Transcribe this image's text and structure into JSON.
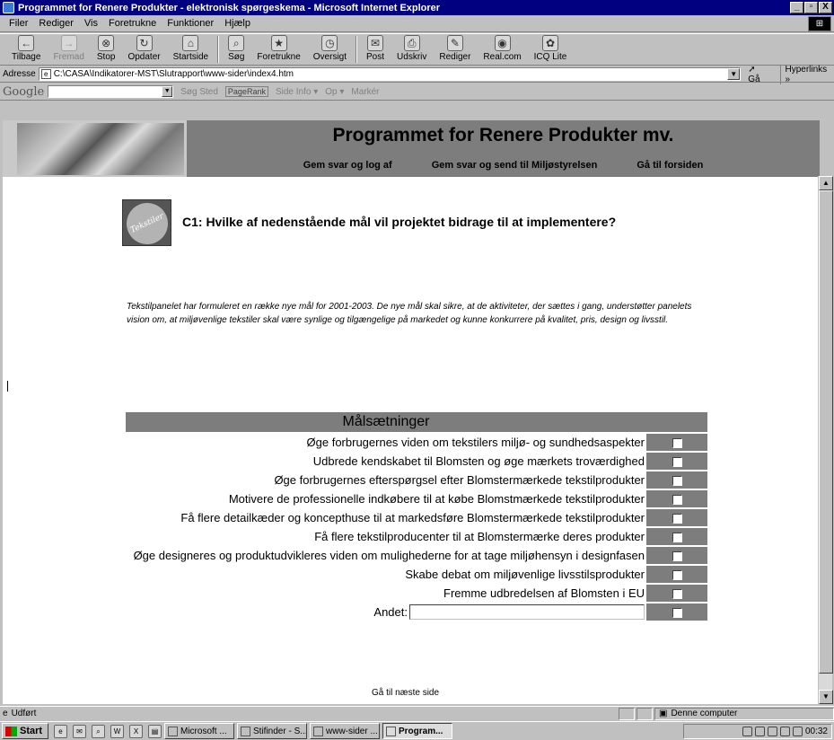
{
  "window": {
    "title": "Programmet for Renere Produkter - elektronisk spørgeskema - Microsoft Internet Explorer",
    "minimize": "_",
    "maximize": "▫",
    "close": "X"
  },
  "menubar": {
    "items": [
      "Filer",
      "Rediger",
      "Vis",
      "Foretrukne",
      "Funktioner",
      "Hjælp"
    ]
  },
  "toolbar": {
    "buttons": [
      {
        "label": "Tilbage",
        "icon": "back-arrow-icon",
        "glyph": "←",
        "enabled": true
      },
      {
        "label": "Fremad",
        "icon": "forward-arrow-icon",
        "glyph": "→",
        "enabled": false
      },
      {
        "label": "Stop",
        "icon": "stop-icon",
        "glyph": "⊗",
        "enabled": true
      },
      {
        "label": "Opdater",
        "icon": "refresh-icon",
        "glyph": "↻",
        "enabled": true
      },
      {
        "label": "Startside",
        "icon": "home-icon",
        "glyph": "⌂",
        "enabled": true
      },
      {
        "label": "Søg",
        "icon": "search-icon",
        "glyph": "⌕",
        "enabled": true
      },
      {
        "label": "Foretrukne",
        "icon": "favorites-icon",
        "glyph": "★",
        "enabled": true
      },
      {
        "label": "Oversigt",
        "icon": "history-icon",
        "glyph": "◷",
        "enabled": true
      },
      {
        "label": "Post",
        "icon": "mail-icon",
        "glyph": "✉",
        "enabled": true
      },
      {
        "label": "Udskriv",
        "icon": "print-icon",
        "glyph": "⎙",
        "enabled": true
      },
      {
        "label": "Rediger",
        "icon": "edit-icon",
        "glyph": "✎",
        "enabled": true
      },
      {
        "label": "Real.com",
        "icon": "realcom-icon",
        "glyph": "◉",
        "enabled": true
      },
      {
        "label": "ICQ Lite",
        "icon": "icq-icon",
        "glyph": "✿",
        "enabled": true
      }
    ]
  },
  "addressbar": {
    "label": "Adresse",
    "url": "C:\\CASA\\Indikatorer-MST\\Slutrapport\\www-sider\\index4.htm",
    "go_label": "Gå",
    "links_label": "Hyperlinks »"
  },
  "googlebar": {
    "logo": "Google",
    "items": [
      "Søg Sted",
      "PageRank",
      "Side Info ▾",
      "Op ▾",
      "Markér"
    ]
  },
  "page": {
    "site_title": "Programmet for Renere Produkter mv.",
    "nav": [
      "Gem svar og log af",
      "Gem svar og send til Miljøstyrelsen",
      "Gå til forsiden"
    ],
    "icon_caption": "Tekstiler",
    "question": "C1: Hvilke af nedenstående mål vil projektet bidrage til at implementere?",
    "intro": "Tekstilpanelet har formuleret en række nye mål for 2001-2003. De nye mål skal sikre, at de aktiviteter, der sættes i gang, understøtter panelets vision om, at miljøvenlige tekstiler skal være synlige og tilgængelige på markedet og kunne konkurrere på kvalitet, pris, design og livsstil.",
    "table_header": "Målsætninger",
    "goals": [
      "Øge forbrugernes viden om tekstilers miljø- og sundhedsaspekter",
      "Udbrede kendskabet til Blomsten og øge mærkets troværdighed",
      "Øge forbrugernes efterspørgsel efter Blomstermærkede tekstilprodukter",
      "Motivere de professionelle indkøbere til at købe Blomstmærkede tekstilprodukter",
      "Få flere detailkæder og koncepthuse til at markedsføre Blomstermærkede tekstilprodukter",
      "Få flere tekstilproducenter til at Blomstermærke deres produkter",
      "Øge designeres og produktudvikleres viden om mulighederne for at tage miljøhensyn i designfasen",
      "Skabe debat om miljøvenlige livsstilsprodukter",
      "Fremme udbredelsen af Blomsten i EU"
    ],
    "other_label": "Andet:",
    "other_value": "",
    "next_link": "Gå til næste side"
  },
  "statusbar": {
    "status": "Udført",
    "zone": "Denne computer"
  },
  "taskbar": {
    "start": "Start",
    "tasks": [
      "Microsoft ...",
      "Stifinder - S...",
      "www-sider ...",
      "Program..."
    ],
    "clock": "00:32"
  }
}
